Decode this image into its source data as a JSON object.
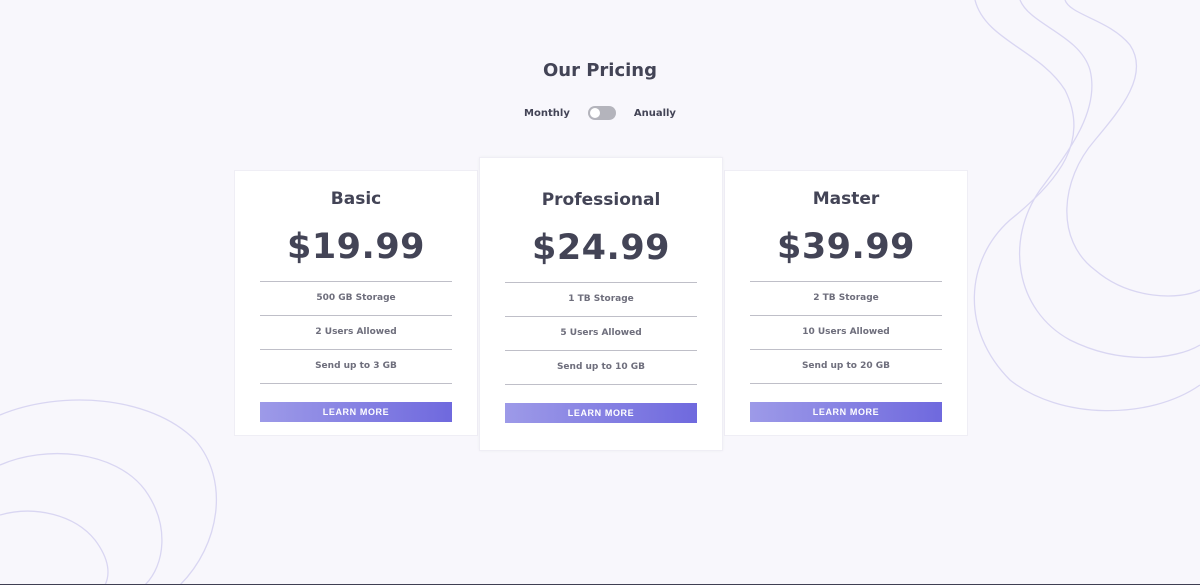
{
  "header": {
    "title": "Our Pricing"
  },
  "billing_toggle": {
    "left_label": "Monthly",
    "right_label": "Anually",
    "state": "monthly"
  },
  "plans": [
    {
      "name": "Basic",
      "price": "$19.99",
      "features": [
        "500 GB Storage",
        "2 Users Allowed",
        "Send up to 3 GB"
      ],
      "cta": "LEARN MORE"
    },
    {
      "name": "Professional",
      "price": "$24.99",
      "features": [
        "1 TB Storage",
        "5 Users Allowed",
        "Send up to 10 GB"
      ],
      "cta": "LEARN MORE"
    },
    {
      "name": "Master",
      "price": "$39.99",
      "features": [
        "2 TB Storage",
        "10 Users Allowed",
        "Send up to 20 GB"
      ],
      "cta": "LEARN MORE"
    }
  ],
  "colors": {
    "background": "#f8f7fc",
    "text_dark": "#434456",
    "accent_start": "#9d9ae8",
    "accent_end": "#6f69de",
    "decor_lines": "#d9d6f2"
  }
}
